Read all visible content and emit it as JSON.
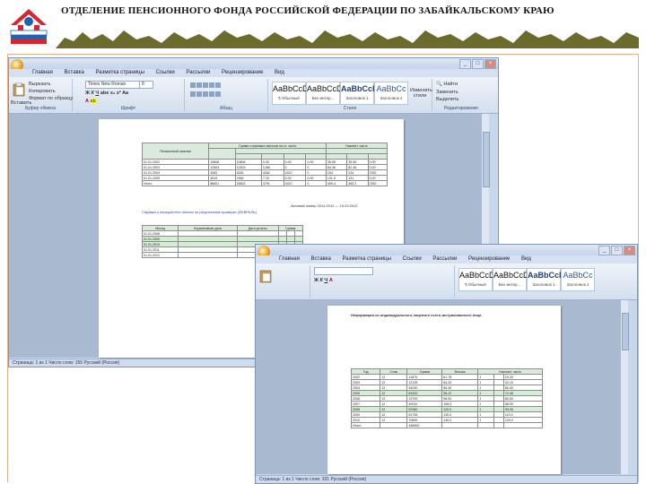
{
  "slide": {
    "title": "ОТДЕЛЕНИЕ ПЕНСИОННОГО ФОНДА РОССИЙСКОЙ ФЕДЕРАЦИИ ПО ЗАБАЙКАЛЬСКОМУ КРАЮ",
    "accent_color": "#e8b08a",
    "logo_colors": [
      "#1d63b7",
      "#d8262e",
      "#ffffff"
    ]
  },
  "window1": {
    "tabs": [
      "Главная",
      "Вставка",
      "Разметка страницы",
      "Ссылки",
      "Рассылки",
      "Рецензирование",
      "Вид"
    ],
    "font_name": "Times New Roman",
    "font_size": "8",
    "groups": [
      "Буфер обмена",
      "Шрифт",
      "Абзац",
      "Стили",
      "Редактирование"
    ],
    "clipboard": [
      "Вставить",
      "Вырезать",
      "Копировать",
      "Формат по образцу"
    ],
    "styles": [
      {
        "preview": "AaBbCcDd",
        "name": "¶ Обычный"
      },
      {
        "preview": "AaBbCcDd",
        "name": "Без интер..."
      },
      {
        "preview": "AaBbCcE",
        "name": "Заголовок 1"
      },
      {
        "preview": "AaBbCc",
        "name": "Заголовок 2"
      }
    ],
    "change_styles": "Изменить стили",
    "editing": [
      "Найти",
      "Заменить",
      "Выделить"
    ],
    "status": "Страница: 1 из 1   Число слов: 155   Русский (Россия)",
    "table_head": "Актовый номер 2011-2012 — 19.03.2012",
    "link_text": "Справка о перерасчете пенсии по результатам проверки (ФЕВРАЛЬ)"
  },
  "window2": {
    "tabs": [
      "Главная",
      "Вставка",
      "Разметка страницы",
      "Ссылки",
      "Рассылки",
      "Рецензирование",
      "Вид"
    ],
    "styles": [
      {
        "preview": "AaBbCcDd",
        "name": "¶ Обычный"
      },
      {
        "preview": "AaBbCcDd",
        "name": "Без интер..."
      },
      {
        "preview": "AaBbCcE",
        "name": "Заголовок 1"
      },
      {
        "preview": "AaBbCc",
        "name": "Заголовок 2"
      }
    ],
    "doc_title": "Информация из индивидуального лицевого счета застрахованного лица",
    "status": "Страница: 1 из 1   Число слов: 331   Русский (Россия)"
  }
}
